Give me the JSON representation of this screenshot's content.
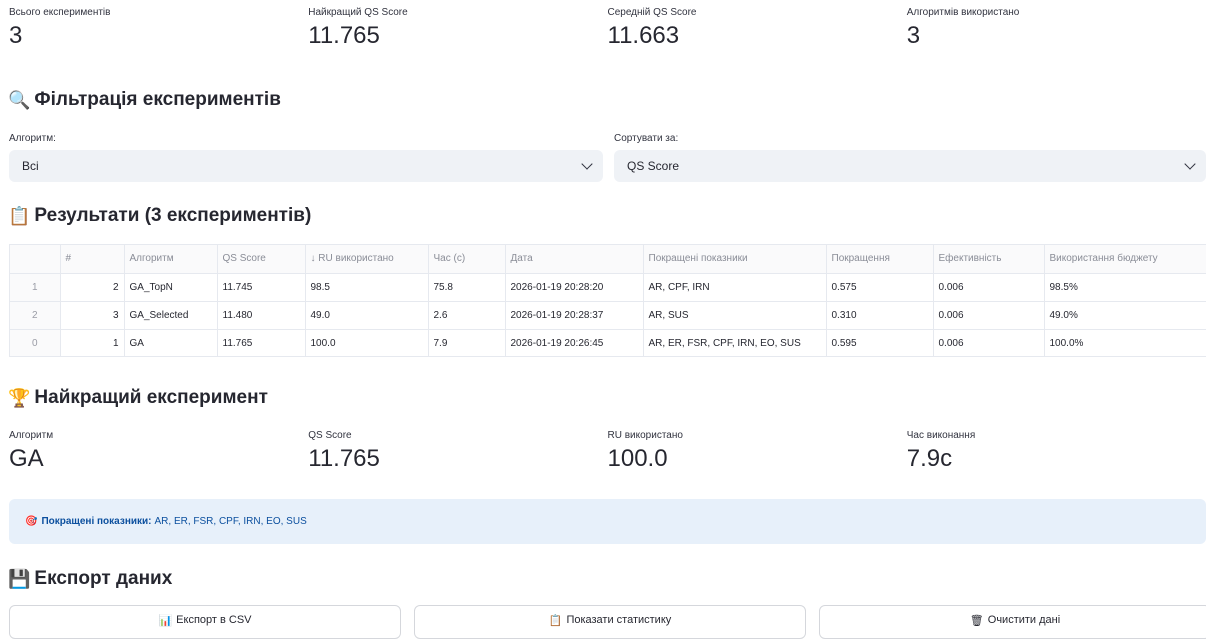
{
  "summary": [
    {
      "label": "Всього експериментів",
      "value": "3"
    },
    {
      "label": "Найкращий QS Score",
      "value": "11.765"
    },
    {
      "label": "Середній QS Score",
      "value": "11.663"
    },
    {
      "label": "Алгоритмів використано",
      "value": "3"
    }
  ],
  "filter": {
    "icon": "🔍",
    "title": "Фільтрація експериментів",
    "algorithm_label": "Алгоритм:",
    "algorithm_value": "Всі",
    "sort_label": "Сортувати за:",
    "sort_value": "QS Score"
  },
  "results": {
    "icon": "📋",
    "title": "Результати (3 експериментів)",
    "columns": [
      "",
      "#",
      "Алгоритм",
      "QS Score",
      "↓ RU використано",
      "Час (с)",
      "Дата",
      "Покращені показники",
      "Покращення",
      "Ефективність",
      "Використання бюджету"
    ],
    "rows": [
      [
        "1",
        "2",
        "GA_TopN",
        "11.745",
        "98.5",
        "75.8",
        "2026-01-19 20:28:20",
        "AR, CPF, IRN",
        "0.575",
        "0.006",
        "98.5%"
      ],
      [
        "2",
        "3",
        "GA_Selected",
        "11.480",
        "49.0",
        "2.6",
        "2026-01-19 20:28:37",
        "AR, SUS",
        "0.310",
        "0.006",
        "49.0%"
      ],
      [
        "0",
        "1",
        "GA",
        "11.765",
        "100.0",
        "7.9",
        "2026-01-19 20:26:45",
        "AR, ER, FSR, CPF, IRN, EO, SUS",
        "0.595",
        "0.006",
        "100.0%"
      ]
    ]
  },
  "best": {
    "icon": "🏆",
    "title": "Найкращий експеримент",
    "metrics": [
      {
        "label": "Алгоритм",
        "value": "GA"
      },
      {
        "label": "QS Score",
        "value": "11.765"
      },
      {
        "label": "RU використано",
        "value": "100.0"
      },
      {
        "label": "Час виконання",
        "value": "7.9с"
      }
    ],
    "info_icon": "🎯",
    "info_label": "Покращені показники:",
    "info_value": "AR, ER, FSR, CPF, IRN, EO, SUS"
  },
  "export": {
    "icon": "💾",
    "title": "Експорт даних",
    "buttons": [
      {
        "icon": "📊",
        "label": "Експорт в CSV"
      },
      {
        "icon": "📋",
        "label": "Показати статистику"
      },
      {
        "icon": "🗑",
        "label": "Очистити дані"
      }
    ]
  }
}
